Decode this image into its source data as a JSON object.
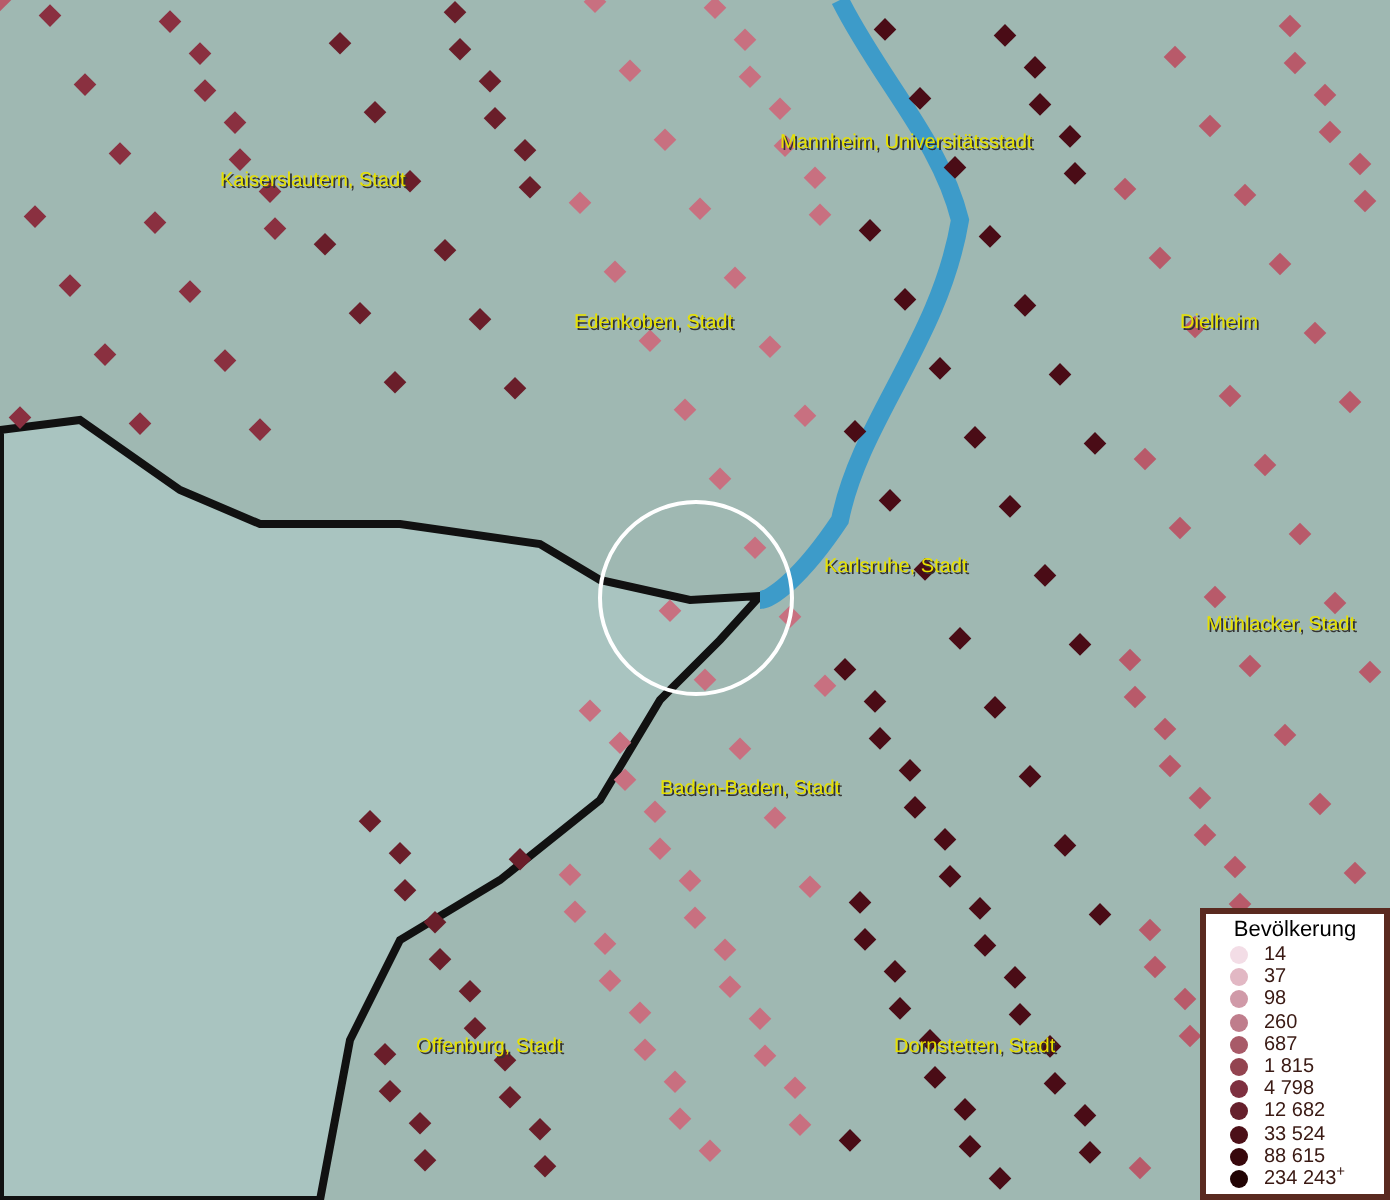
{
  "map": {
    "places": [
      {
        "name": "Kaiserslautern, Stadt"
      },
      {
        "name": "Mannheim, Universitätsstadt"
      },
      {
        "name": "Edenkoben, Stadt"
      },
      {
        "name": "Dielheim"
      },
      {
        "name": "Karlsruhe, Stadt"
      },
      {
        "name": "Mühlacker, Stadt"
      },
      {
        "name": "Baden-Baden, Stadt"
      },
      {
        "name": "Offenburg, Stadt"
      },
      {
        "name": "Dornstetten, Stadt"
      }
    ]
  },
  "legend": {
    "title": "Bevölkerung",
    "items": [
      {
        "label": "14",
        "color": "#f3dde6"
      },
      {
        "label": "37",
        "color": "#e2b8c4"
      },
      {
        "label": "98",
        "color": "#d09aa8"
      },
      {
        "label": "260",
        "color": "#bf7d8c"
      },
      {
        "label": "687",
        "color": "#a85a68"
      },
      {
        "label": "1 815",
        "color": "#934450"
      },
      {
        "label": "4 798",
        "color": "#7e3040"
      },
      {
        "label": "12 682",
        "color": "#66202c"
      },
      {
        "label": "33 524",
        "color": "#4c1018"
      },
      {
        "label": "88 615",
        "color": "#38080c"
      },
      {
        "label": "234 243$^{+}$",
        "color": "#220404"
      }
    ]
  }
}
